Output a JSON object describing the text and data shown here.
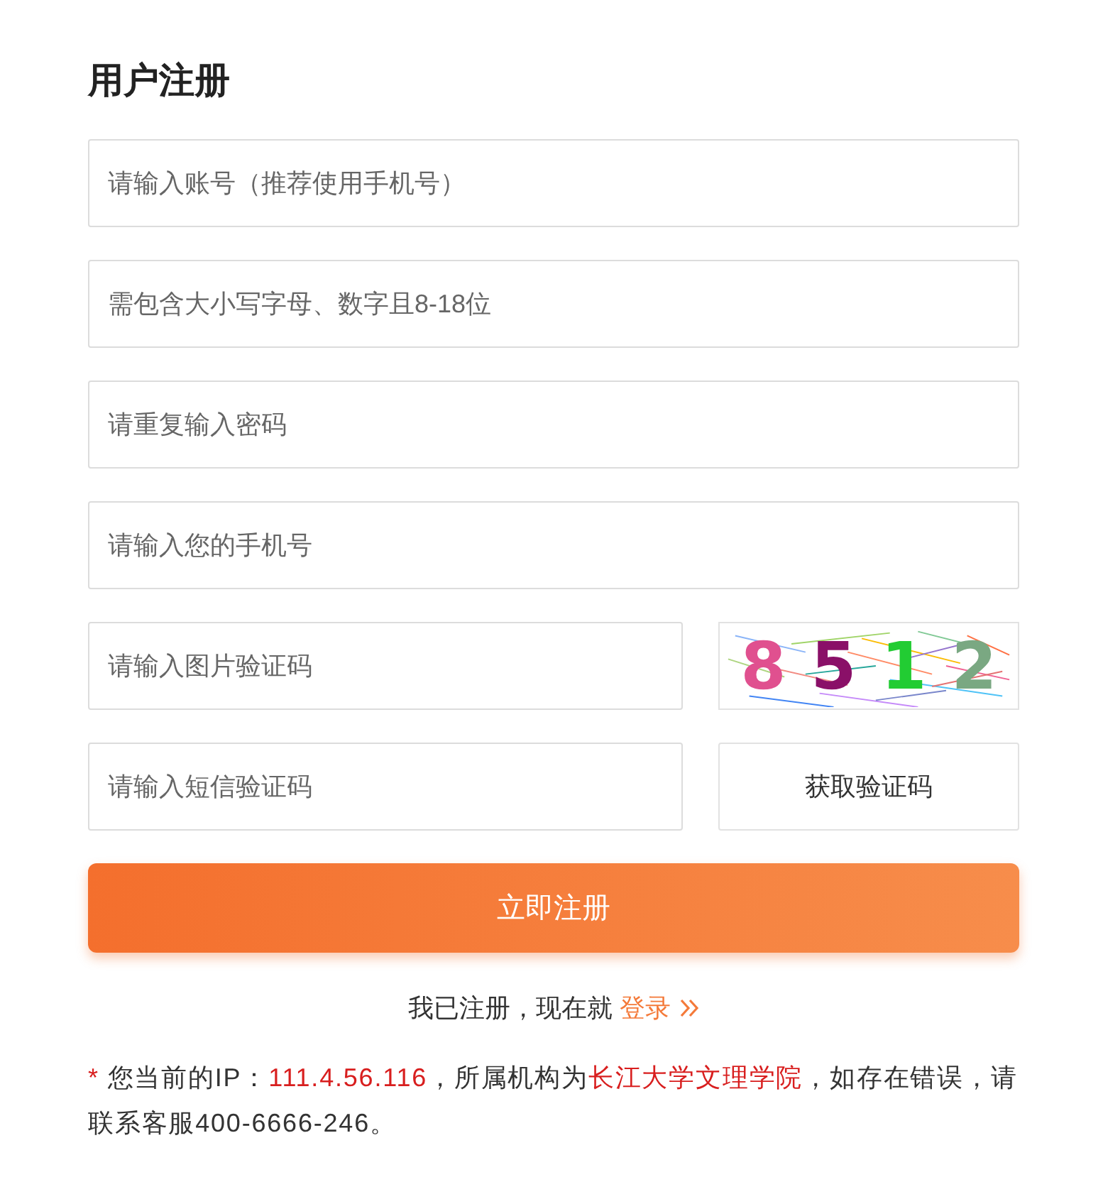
{
  "title": "用户注册",
  "rows": [
    {
      "placeholder": "请输入账号（推荐使用手机号）"
    },
    {
      "placeholder": "需包含大小写字母、数字且8-18位"
    },
    {
      "placeholder": "请重复输入密码"
    },
    {
      "placeholder": "请输入您的手机号"
    },
    {
      "placeholder": "请输入图片验证码",
      "side": {
        "kind": "captcha",
        "digits": [
          {
            "text": "8",
            "color": "#e0508f"
          },
          {
            "text": "5",
            "color": "#8a1068"
          },
          {
            "text": "1",
            "color": "#22cc33"
          },
          {
            "text": "2",
            "color": "#7aa882"
          }
        ]
      }
    },
    {
      "placeholder": "请输入短信验证码",
      "side": {
        "kind": "button",
        "label": "获取验证码"
      }
    }
  ],
  "submit": "立即注册",
  "login_line": {
    "text": "我已注册，现在就",
    "link": "登录"
  },
  "notice": [
    {
      "text": "*",
      "highlight": true
    },
    {
      "text": " 您当前的IP：",
      "highlight": false
    },
    {
      "text": "111.4.56.116",
      "highlight": true
    },
    {
      "text": "，所属机构为",
      "highlight": false
    },
    {
      "text": "长江大学文理学院",
      "highlight": true
    },
    {
      "text": "，如存在错误，请联系客服400-6666-246。",
      "highlight": false
    }
  ]
}
